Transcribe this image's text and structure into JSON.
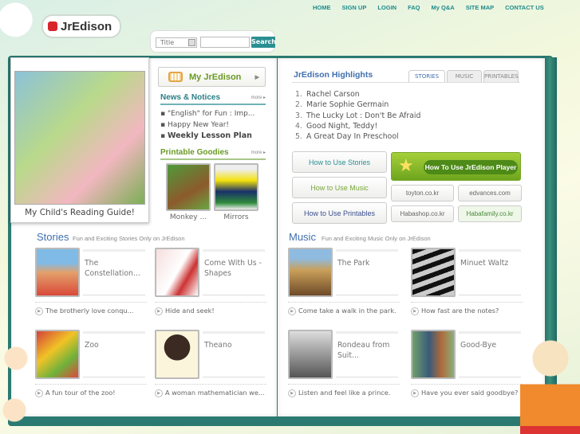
{
  "nav": [
    "HOME",
    "SIGN UP",
    "LOGIN",
    "FAQ",
    "My Q&A",
    "SITE MAP",
    "CONTACT US"
  ],
  "logo": "JrEdison",
  "search": {
    "select": "Title",
    "value": "",
    "button": "Search"
  },
  "guide": {
    "caption": "My Child's Reading Guide!"
  },
  "my_jredison": "My JrEdison",
  "news": {
    "title": "News & Notices",
    "more": "more ▸",
    "items": [
      "\"English\" for Fun : Imp...",
      "Happy New Year!",
      "Weekly Lesson Plan"
    ]
  },
  "goodies": {
    "title": "Printable Goodies",
    "more": "more ▸",
    "items": [
      "Monkey ...",
      "Mirrors"
    ]
  },
  "highlights": {
    "title": "JrEdison Highlights",
    "tabs": [
      "STORIES",
      "MUSIC",
      "PRINTABLES"
    ],
    "nums": [
      "1.",
      "2.",
      "3.",
      "4.",
      "5."
    ],
    "items": [
      "Rachel Carson",
      "Marie Sophie Germain",
      "The Lucky Lot : Don't Be Afraid",
      "Good Night, Teddy!",
      "A Great Day In Preschool"
    ]
  },
  "howto": {
    "stories": "How to Use Stories",
    "music": "How to Use Music",
    "printables": "How to Use Printables",
    "player": "How To Use JrEdison Player"
  },
  "links": [
    "toyton.co.kr",
    "edvances.com",
    "Habashop.co.kr",
    "Habafamily.co.kr"
  ],
  "stories": {
    "title": "Stories",
    "subtitle": "Fun and Exciting Stories Only on JrEdison",
    "items": [
      {
        "name": "The Constellation...",
        "desc": "The brotherly love conqu..."
      },
      {
        "name": "Come With Us - Shapes",
        "desc": "Hide and seek!"
      },
      {
        "name": "Zoo",
        "desc": "A fun tour of the zoo!"
      },
      {
        "name": "Theano",
        "desc": "A woman mathematician we..."
      }
    ]
  },
  "music": {
    "title": "Music",
    "subtitle": "Fun and Exciting Music Only on JrEdison",
    "items": [
      {
        "name": "The Park",
        "desc": "Come take a walk in the park."
      },
      {
        "name": "Minuet Waltz",
        "desc": "How fast are the notes?"
      },
      {
        "name": "Rondeau from Suit...",
        "desc": "Listen and feel like a prince."
      },
      {
        "name": "Good-Bye",
        "desc": "Have you ever said goodbye?"
      }
    ]
  },
  "colors": {
    "accent": "#2a8f92",
    "title": "#3f6fae",
    "green": "#6a9a24"
  }
}
